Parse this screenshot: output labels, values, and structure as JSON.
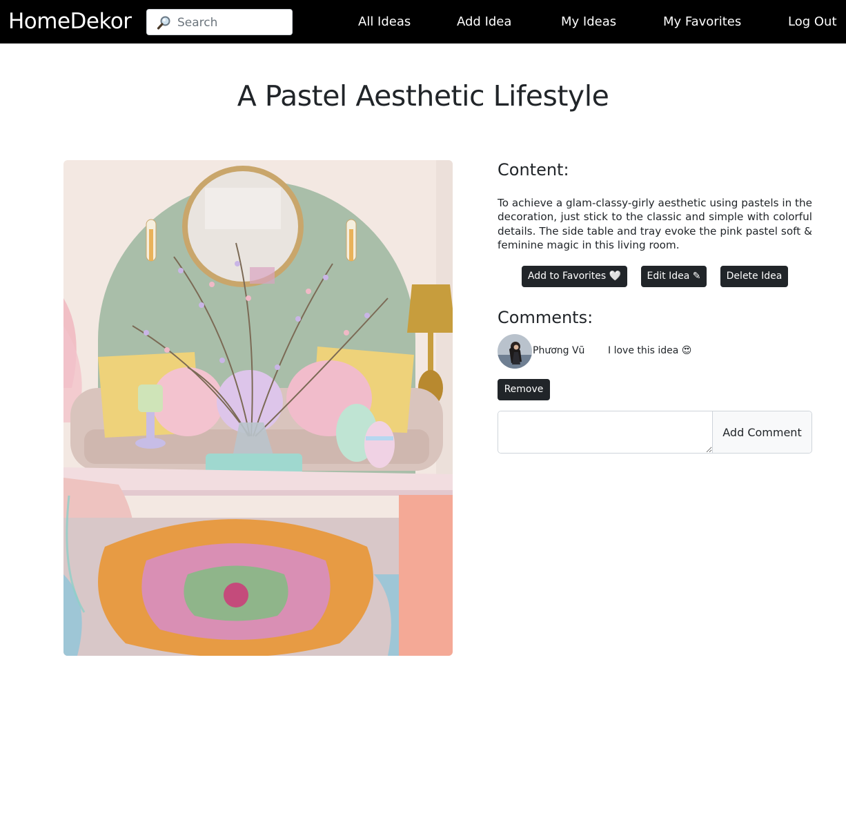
{
  "navbar": {
    "brand": "HomeDekor",
    "search_placeholder": "Search",
    "links": [
      "All Ideas",
      "Add Idea",
      "My Ideas",
      "My Favorites",
      "Log Out"
    ]
  },
  "idea": {
    "title": "A Pastel Aesthetic Lifestyle",
    "content_heading": "Content:",
    "content": "To achieve a glam-classy-girly aesthetic using pastels in the decoration, just stick to the classic and simple with colorful details. The side table and tray evoke the pink pastel soft & feminine magic in this living room.",
    "image_icon": "pastel-living-room-photo"
  },
  "actions": {
    "favorite_label": "Add to Favorites 🤍",
    "edit_label": "Edit Idea ✎",
    "delete_label": "Delete Idea"
  },
  "comments": {
    "heading": "Comments:",
    "items": [
      {
        "user": "Phương Vũ",
        "text": "I love this idea 😍",
        "remove_label": "Remove"
      }
    ],
    "add_button_label": "Add Comment",
    "new_comment_value": ""
  },
  "colors": {
    "navbar_bg": "#000000",
    "button_dark": "#212529",
    "text": "#212529"
  }
}
